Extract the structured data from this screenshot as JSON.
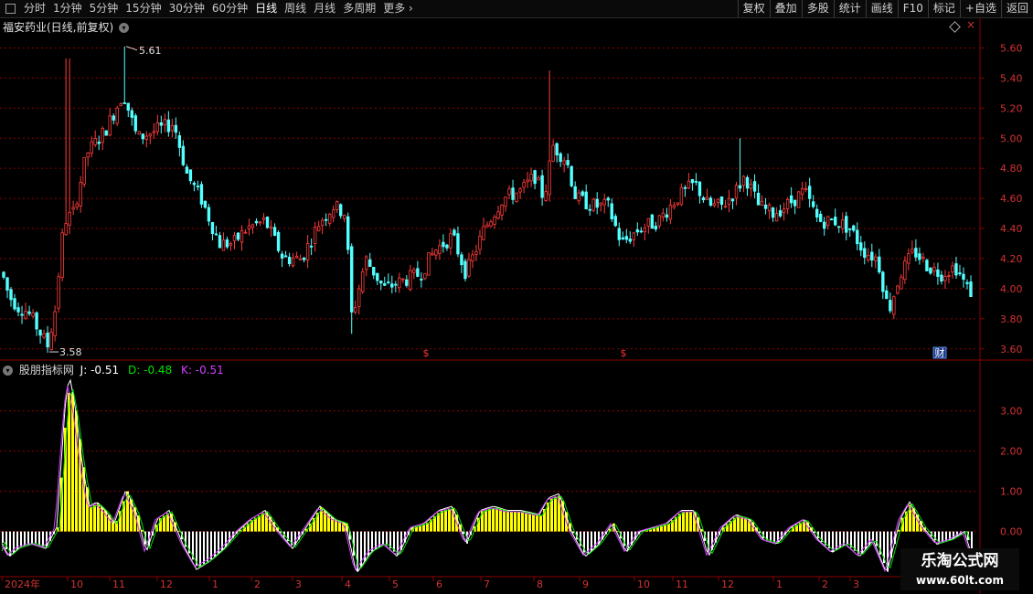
{
  "toolbar": {
    "periods": [
      "分时",
      "1分钟",
      "5分钟",
      "15分钟",
      "30分钟",
      "60分钟",
      "日线",
      "周线",
      "月线",
      "多周期",
      "更多"
    ],
    "active_period": "日线",
    "more_arrow": "chevron-right-icon",
    "buttons": [
      "复权",
      "叠加",
      "多股",
      "统计",
      "画线",
      "F10",
      "标记",
      "+自选",
      "返回"
    ]
  },
  "main_chart": {
    "title": "福安药业(日线,前复权)",
    "high_label": "5.61",
    "low_label": "3.58",
    "y_ticks": [
      "5.60",
      "5.40",
      "5.20",
      "5.00",
      "4.80",
      "4.60",
      "4.40",
      "4.20",
      "4.00",
      "3.80",
      "3.60"
    ],
    "markers": [
      {
        "text": "$",
        "color": "#ff3232"
      },
      {
        "text": "$",
        "color": "#ff3232"
      },
      {
        "text": "财",
        "color": "#ffffff"
      }
    ]
  },
  "indicator": {
    "name": "股朋指标网",
    "j_label": "J:",
    "j_value": "-0.51",
    "d_label": "D:",
    "d_value": "-0.48",
    "k_label": "K:",
    "k_value": "-0.51",
    "j_color": "#ffffff",
    "d_color": "#00e000",
    "k_color": "#d040ff",
    "y_ticks": [
      "3.00",
      "2.00",
      "1.00",
      "0.00"
    ]
  },
  "x_axis": {
    "labels": [
      "2024年",
      "10",
      "11",
      "12",
      "1",
      "2",
      "3",
      "4",
      "5",
      "6",
      "7",
      "8",
      "9",
      "10",
      "11",
      "12",
      "1",
      "2",
      "3"
    ]
  },
  "watermark": {
    "line1": "乐淘公式网",
    "line2": "www.60lt.com"
  },
  "colors": {
    "up": "#ff3c3c",
    "down": "#54ffff",
    "grid": "#8b0000",
    "axis_text": "#d23232",
    "bar_fill": "#ffff00"
  }
}
